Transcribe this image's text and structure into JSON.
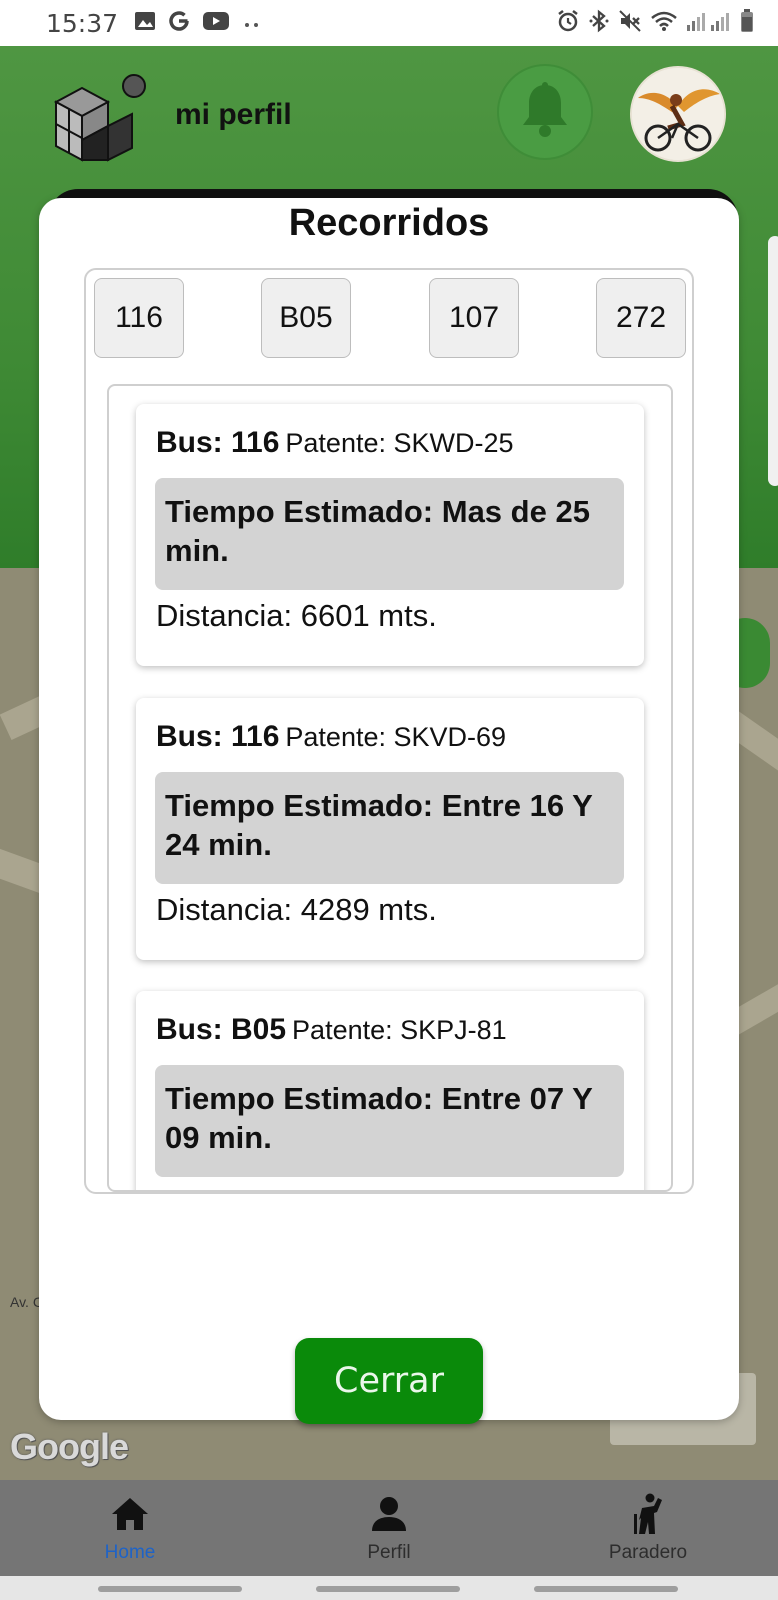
{
  "status_bar": {
    "time": "15:37"
  },
  "header": {
    "title": "mi perfil"
  },
  "modal": {
    "title": "Recorridos",
    "routes": [
      "116",
      "B05",
      "107",
      "272"
    ],
    "cards": [
      {
        "bus_prefix": "Bus: 116",
        "patente": "Patente: SKWD-25",
        "eta": "Tiempo Estimado: Mas de 25 min.",
        "distance": "Distancia: 6601 mts."
      },
      {
        "bus_prefix": "Bus: 116",
        "patente": "Patente: SKVD-69",
        "eta": "Tiempo Estimado: Entre 16 Y 24 min.",
        "distance": "Distancia: 4289 mts."
      },
      {
        "bus_prefix": "Bus: B05",
        "patente": "Patente: SKPJ-81",
        "eta": "Tiempo Estimado: Entre 07 Y 09 min.",
        "distance": ""
      }
    ],
    "close_label": "Cerrar"
  },
  "map": {
    "google_label": "Google",
    "street_label": "Av. C"
  },
  "nav": {
    "items": [
      "Home",
      "Perfil",
      "Paradero"
    ],
    "active": "Home"
  },
  "colors": {
    "header_green": "#4f9642",
    "close_green": "#0a8a0a",
    "nav_active": "#1e63c7"
  },
  "icons": [
    "image-icon",
    "google-icon",
    "youtube-icon",
    "alarm-icon",
    "bluetooth-icon",
    "mute-icon",
    "wifi-icon",
    "signal-icon",
    "battery-icon",
    "bell-icon",
    "home-icon",
    "person-icon",
    "bus-stop-icon"
  ]
}
